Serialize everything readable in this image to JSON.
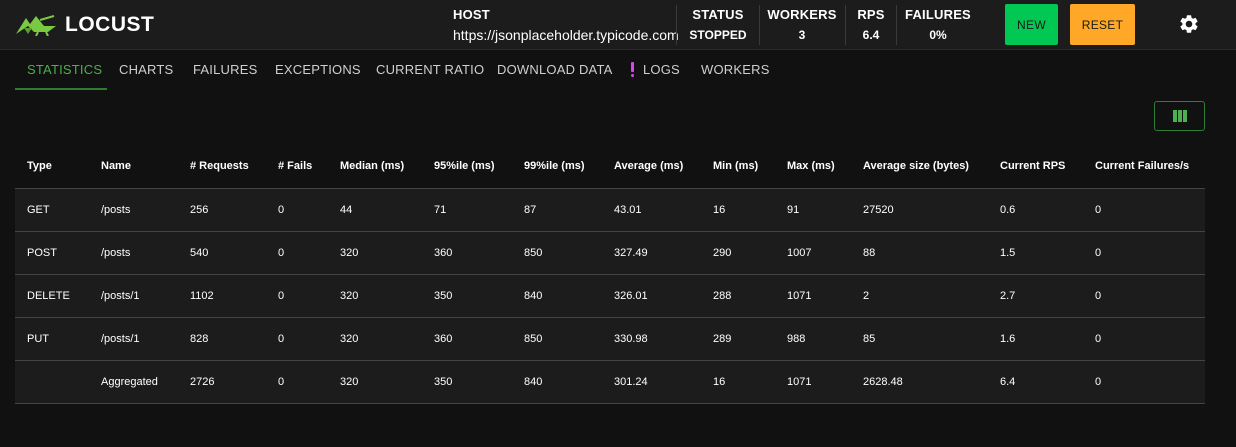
{
  "brand": {
    "name": "LOCUST",
    "accent": "#7ac943"
  },
  "header": {
    "host_label": "HOST",
    "host_value": "https://jsonplaceholder.typicode.com",
    "status_label": "STATUS",
    "status_value": "STOPPED",
    "workers_label": "WORKERS",
    "workers_value": "3",
    "rps_label": "RPS",
    "rps_value": "6.4",
    "failures_label": "FAILURES",
    "failures_value": "0%",
    "new_label": "NEW",
    "reset_label": "RESET",
    "new_color": "#00c853",
    "reset_color": "#ffa726",
    "settings_icon": "gear-icon"
  },
  "tabs": [
    {
      "label": "STATISTICS",
      "active": true
    },
    {
      "label": "CHARTS"
    },
    {
      "label": "FAILURES"
    },
    {
      "label": "EXCEPTIONS"
    },
    {
      "label": "CURRENT RATIO"
    },
    {
      "label": "DOWNLOAD DATA"
    },
    {
      "label": "LOGS",
      "icon": "exclamation-icon",
      "icon_color": "#e040fb"
    },
    {
      "label": "WORKERS"
    }
  ],
  "table": {
    "columns_icon": "columns-icon",
    "headers": [
      "Type",
      "Name",
      "# Requests",
      "# Fails",
      "Median (ms)",
      "95%ile (ms)",
      "99%ile (ms)",
      "Average (ms)",
      "Min (ms)",
      "Max (ms)",
      "Average size (bytes)",
      "Current RPS",
      "Current Failures/s"
    ],
    "rows": [
      [
        "GET",
        "/posts",
        "256",
        "0",
        "44",
        "71",
        "87",
        "43.01",
        "16",
        "91",
        "27520",
        "0.6",
        "0"
      ],
      [
        "POST",
        "/posts",
        "540",
        "0",
        "320",
        "360",
        "850",
        "327.49",
        "290",
        "1007",
        "88",
        "1.5",
        "0"
      ],
      [
        "DELETE",
        "/posts/1",
        "1102",
        "0",
        "320",
        "350",
        "840",
        "326.01",
        "288",
        "1071",
        "2",
        "2.7",
        "0"
      ],
      [
        "PUT",
        "/posts/1",
        "828",
        "0",
        "320",
        "360",
        "850",
        "330.98",
        "289",
        "988",
        "85",
        "1.6",
        "0"
      ],
      [
        "",
        "Aggregated",
        "2726",
        "0",
        "320",
        "350",
        "840",
        "301.24",
        "16",
        "1071",
        "2628.48",
        "6.4",
        "0"
      ]
    ]
  }
}
